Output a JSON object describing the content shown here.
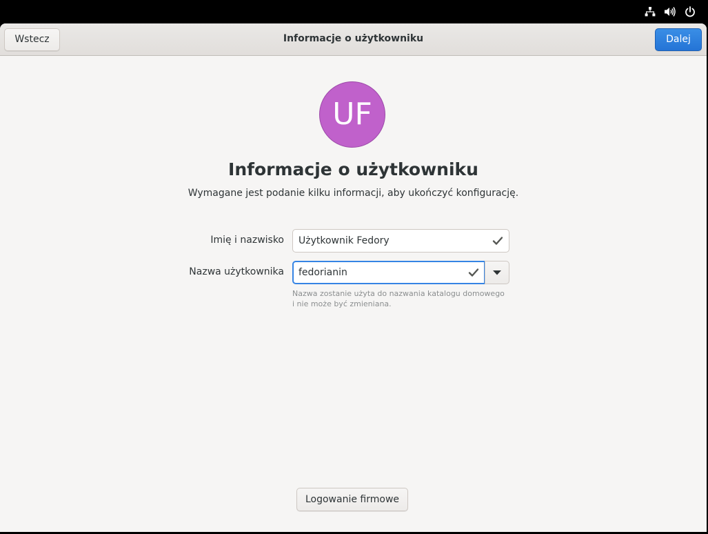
{
  "topbar": {
    "icons": [
      "network-wired-icon",
      "volume-icon",
      "power-icon"
    ]
  },
  "header": {
    "back_label": "Wstecz",
    "title": "Informacje o użytkowniku",
    "next_label": "Dalej"
  },
  "avatar": {
    "initials": "UF",
    "color": "#c061cb"
  },
  "main": {
    "title": "Informacje o użytkowniku",
    "subtitle": "Wymagane jest podanie kilku informacji, aby ukończyć konfigurację."
  },
  "form": {
    "fullname_label": "Imię i nazwisko",
    "fullname_value": "Użytkownik Fedory",
    "username_label": "Nazwa użytkownika",
    "username_value": "fedorianin",
    "hint_line1": "Nazwa zostanie użyta do nazwania katalogu domowego",
    "hint_line2": "i nie może być zmieniana."
  },
  "footer": {
    "enterprise_label": "Logowanie firmowe"
  },
  "colors": {
    "accent": "#3584e4",
    "background": "#f6f5f4",
    "text": "#2e3436"
  }
}
